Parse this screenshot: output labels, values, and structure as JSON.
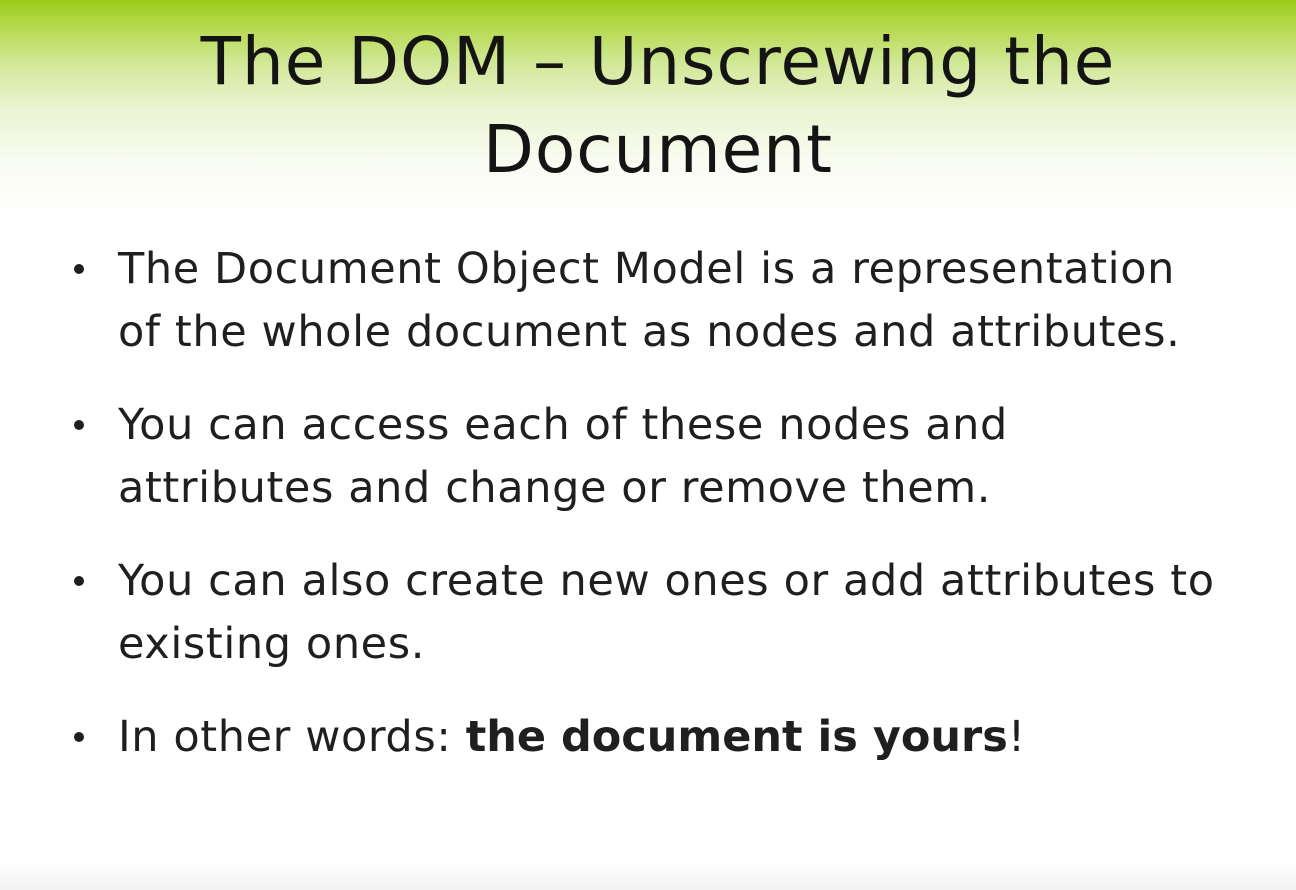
{
  "slide": {
    "title_line1": "The DOM – Unscrewing the",
    "title_line2": "Document",
    "bullets": [
      {
        "text": "The Document Object Model is a representation of the whole document as nodes and attributes."
      },
      {
        "text": "You can access each of these nodes and attributes and change or remove them."
      },
      {
        "text": "You can also create new ones or add attributes to existing ones."
      },
      {
        "prefix": "In other words: ",
        "emphasis": "the document is yours",
        "suffix": "!"
      }
    ]
  },
  "colors": {
    "title_band_top": "#9bcc1a",
    "text": "#1f1f1f",
    "background": "#ffffff"
  }
}
